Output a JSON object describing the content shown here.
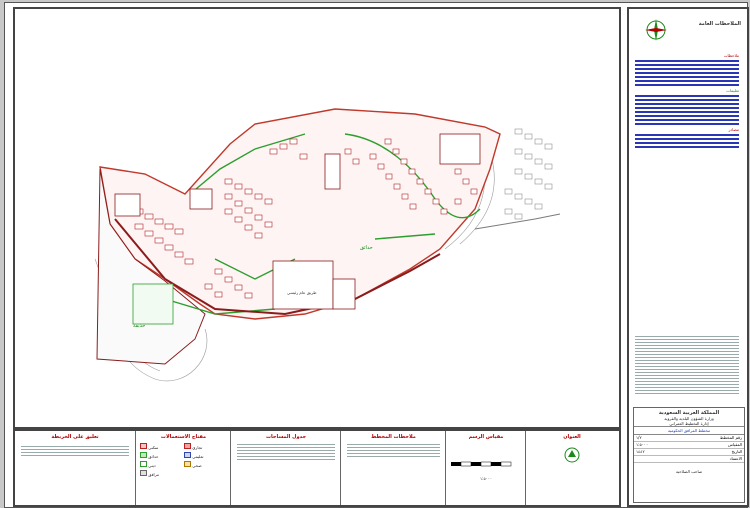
{
  "map": {
    "area_labels": [
      "حدائق",
      "حديقة",
      "طريق عام رئيسي"
    ],
    "colors": {
      "boundary": "#c0392b",
      "road": "#8a1c1c",
      "green": "#2e9e2e",
      "blocks": "#b22222",
      "topo": "#8c8c8c"
    }
  },
  "side_panel": {
    "header_title": "الملاحظات العامة",
    "notes_heading_1": "ملاحظات",
    "notes_heading_2": "تعليمات",
    "notes_heading_3": "مصادر",
    "ministry": "المملكة العربية السعودية",
    "ministry_sub": "وزارة الشؤون البلدية والقروية",
    "department": "إدارة التخطيط العمراني",
    "project": "مخطط المرافق الحكومية",
    "rows": [
      {
        "k": "رقم المخطط",
        "v": "١/٢"
      },
      {
        "k": "المقياس",
        "v": "١:٥٠٠٠"
      },
      {
        "k": "التاريخ",
        "v": "١٤٤٢"
      },
      {
        "k": "الاعتماد",
        "v": ""
      }
    ],
    "footer": "صاحب الصلاحية"
  },
  "legend_strip": {
    "col1_title": "تعليق على الخريطة",
    "col2_title": "مفتاح الاستعمالات",
    "col3_title": "جدول المساحات",
    "col4_title": "ملاحظات المخطط",
    "col5_title": "مقياس الرسم",
    "col6_title": "العنوان",
    "legend_items": [
      "سكني",
      "تجاري",
      "حدائق",
      "تعليمي",
      "ديني",
      "صحي",
      "مرافق"
    ],
    "scale_text": "١:٥٠٠٠"
  }
}
